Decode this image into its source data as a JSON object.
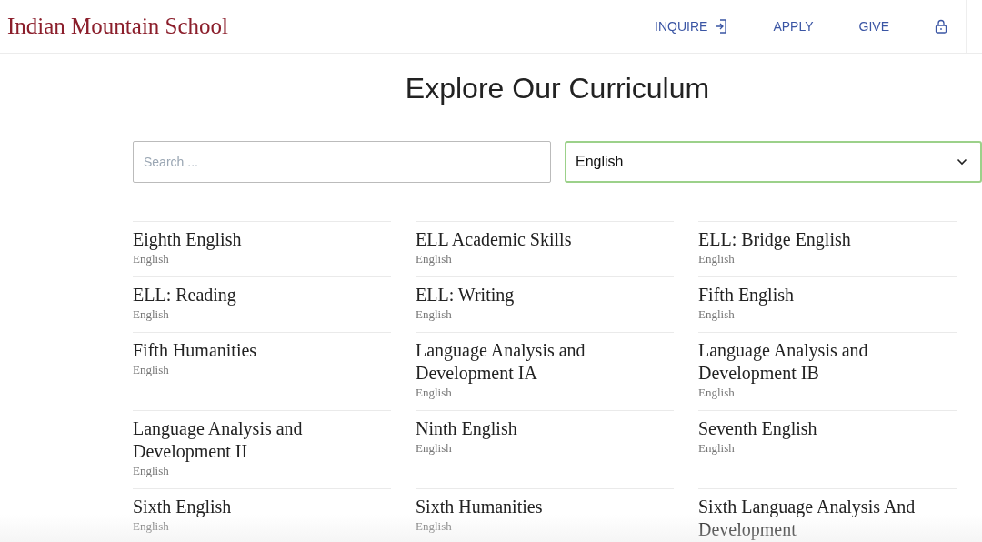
{
  "header": {
    "school_name": "Indian Mountain School",
    "nav": [
      {
        "kind": "link-with-icon",
        "label": "INQUIRE"
      },
      {
        "kind": "link",
        "label": "APPLY"
      },
      {
        "kind": "link",
        "label": "GIVE"
      },
      {
        "kind": "lock"
      }
    ]
  },
  "heading": "Explore Our Curriculum",
  "search": {
    "placeholder": "Search ..."
  },
  "filter": {
    "value": "English"
  },
  "courses": [
    {
      "title": "Eighth English",
      "category": "English"
    },
    {
      "title": "ELL Academic Skills",
      "category": "English"
    },
    {
      "title": "ELL: Bridge English",
      "category": "English"
    },
    {
      "title": "ELL: Reading",
      "category": "English"
    },
    {
      "title": "ELL: Writing",
      "category": "English"
    },
    {
      "title": "Fifth English",
      "category": "English"
    },
    {
      "title": "Fifth Humanities",
      "category": "English"
    },
    {
      "title": "Language Analysis and Development IA",
      "category": "English"
    },
    {
      "title": "Language Analysis and Development IB",
      "category": "English"
    },
    {
      "title": "Language Analysis and Development II",
      "category": "English"
    },
    {
      "title": "Ninth English",
      "category": "English"
    },
    {
      "title": "Seventh English",
      "category": "English"
    },
    {
      "title": "Sixth English",
      "category": "English"
    },
    {
      "title": "Sixth Humanities",
      "category": "English"
    },
    {
      "title": "Sixth Language Analysis And Development"
    }
  ]
}
